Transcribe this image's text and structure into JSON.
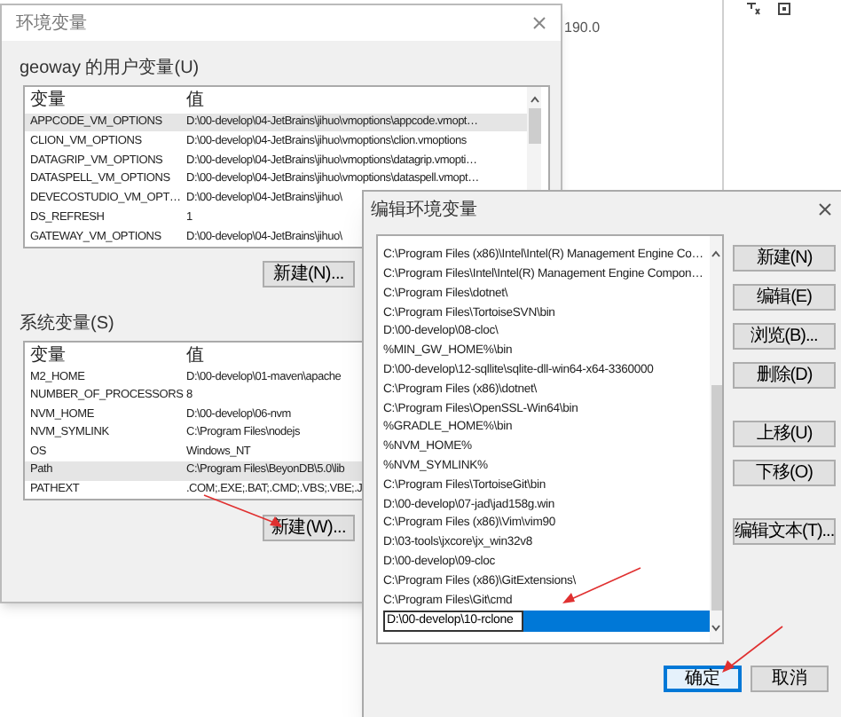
{
  "background_window": {
    "text": "190.0"
  },
  "env_window": {
    "title": "环境变量",
    "user_vars": {
      "label": "geoway 的用户变量(U)",
      "columns": [
        "变量",
        "值"
      ],
      "rows": [
        {
          "name": "APPCODE_VM_OPTIONS",
          "value": "D:\\00-develop\\04-JetBrains\\jihuo\\vmoptions\\appcode.vmopt…",
          "selected": true
        },
        {
          "name": "CLION_VM_OPTIONS",
          "value": "D:\\00-develop\\04-JetBrains\\jihuo\\vmoptions\\clion.vmoptions",
          "selected": false
        },
        {
          "name": "DATAGRIP_VM_OPTIONS",
          "value": "D:\\00-develop\\04-JetBrains\\jihuo\\vmoptions\\datagrip.vmopti…",
          "selected": false
        },
        {
          "name": "DATASPELL_VM_OPTIONS",
          "value": "D:\\00-develop\\04-JetBrains\\jihuo\\vmoptions\\dataspell.vmopt…",
          "selected": false
        },
        {
          "name": "DEVECOSTUDIO_VM_OPT…",
          "value": "D:\\00-develop\\04-JetBrains\\jihuo\\",
          "selected": false
        },
        {
          "name": "DS_REFRESH",
          "value": "1",
          "selected": false
        },
        {
          "name": "GATEWAY_VM_OPTIONS",
          "value": "D:\\00-develop\\04-JetBrains\\jihuo\\",
          "selected": false
        }
      ],
      "new_button": "新建(N)..."
    },
    "system_vars": {
      "label": "系统变量(S)",
      "columns": [
        "变量",
        "值"
      ],
      "rows": [
        {
          "name": "M2_HOME",
          "value": "D:\\00-develop\\01-maven\\apache",
          "selected": false
        },
        {
          "name": "NUMBER_OF_PROCESSORS",
          "value": "8",
          "selected": false
        },
        {
          "name": "NVM_HOME",
          "value": "D:\\00-develop\\06-nvm",
          "selected": false
        },
        {
          "name": "NVM_SYMLINK",
          "value": "C:\\Program Files\\nodejs",
          "selected": false
        },
        {
          "name": "OS",
          "value": "Windows_NT",
          "selected": false
        },
        {
          "name": "Path",
          "value": "C:\\Program Files\\BeyonDB\\5.0\\lib",
          "selected": true
        },
        {
          "name": "PATHEXT",
          "value": ".COM;.EXE;.BAT;.CMD;.VBS;.VBE;.J",
          "selected": false
        }
      ],
      "new_button": "新建(W)..."
    }
  },
  "edit_window": {
    "title": "编辑环境变量",
    "entries": [
      {
        "kind": "item",
        "text": "C:\\Program Files (x86)\\Intel\\Intel(R) Management Engine Co…"
      },
      {
        "kind": "item",
        "text": "C:\\Program Files\\Intel\\Intel(R) Management Engine Compon…"
      },
      {
        "kind": "item",
        "text": "C:\\Program Files\\dotnet\\"
      },
      {
        "kind": "item",
        "text": "C:\\Program Files\\TortoiseSVN\\bin"
      },
      {
        "kind": "item",
        "text": "D:\\00-develop\\08-cloc\\"
      },
      {
        "kind": "item",
        "text": "%MIN_GW_HOME%\\bin"
      },
      {
        "kind": "item",
        "text": "D:\\00-develop\\12-sqllite\\sqlite-dll-win64-x64-3360000"
      },
      {
        "kind": "item",
        "text": "C:\\Program Files (x86)\\dotnet\\"
      },
      {
        "kind": "item",
        "text": "C:\\Program Files\\OpenSSL-Win64\\bin"
      },
      {
        "kind": "item",
        "text": "%GRADLE_HOME%\\bin"
      },
      {
        "kind": "item",
        "text": "%NVM_HOME%"
      },
      {
        "kind": "item",
        "text": "%NVM_SYMLINK%"
      },
      {
        "kind": "item",
        "text": "C:\\Program Files\\TortoiseGit\\bin"
      },
      {
        "kind": "item",
        "text": "D:\\00-develop\\07-jad\\jad158g.win"
      },
      {
        "kind": "item",
        "text": "C:\\Program Files (x86)\\Vim\\vim90"
      },
      {
        "kind": "item",
        "text": "D:\\03-tools\\jxcore\\jx_win32v8"
      },
      {
        "kind": "item",
        "text": "D:\\00-develop\\09-cloc"
      },
      {
        "kind": "item",
        "text": "C:\\Program Files (x86)\\GitExtensions\\"
      },
      {
        "kind": "item",
        "text": "C:\\Program Files\\Git\\cmd"
      },
      {
        "kind": "editing",
        "text": "D:\\00-develop\\10-rclone"
      }
    ],
    "side_button_groups": [
      [
        "新建(N)",
        "编辑(E)",
        "浏览(B)...",
        "删除(D)"
      ],
      [
        "上移(U)",
        "下移(O)"
      ],
      [
        "编辑文本(T)..."
      ]
    ],
    "ok_button": "确定",
    "cancel_button": "取消"
  }
}
